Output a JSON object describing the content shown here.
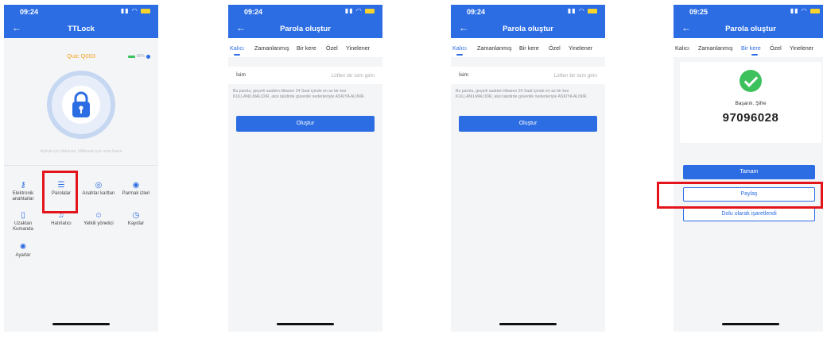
{
  "colors": {
    "primary": "#2c6de3",
    "highlight": "#e4141b",
    "success": "#3cc15c",
    "lock_name": "#f2a21d"
  },
  "screen1": {
    "time": "09:24",
    "title": "TTLock",
    "lock_name": "Quic Q003",
    "battery": "80%",
    "hint": "Açmak için dokunun, kilitlemek için uzun basın",
    "menu": [
      {
        "label": "Elektronik anahtarlar",
        "icon": "key-icon"
      },
      {
        "label": "Parolalar",
        "icon": "password-list-icon"
      },
      {
        "label": "Anahtar kartları",
        "icon": "card-icon"
      },
      {
        "label": "Parmak izleri",
        "icon": "fingerprint-icon"
      },
      {
        "label": "Uzaktan Kumanda",
        "icon": "remote-icon"
      },
      {
        "label": "Hatırlatıcı",
        "icon": "bell-icon"
      },
      {
        "label": "Yetkili yönetici",
        "icon": "admin-icon"
      },
      {
        "label": "Kayıtlar",
        "icon": "history-icon"
      },
      {
        "label": "Ayarlar",
        "icon": "settings-icon"
      }
    ]
  },
  "screen2": {
    "time": "09:24",
    "title": "Parola oluştur",
    "tabs": [
      "Kalıcı",
      "Zamanlanmış",
      "Bir kere",
      "Özel",
      "Yinelener"
    ],
    "active_tab": 0,
    "name_label": "İsim",
    "name_placeholder": "Lütfen bir isim girin",
    "note": "Bu parola, geçerli saatten itibaren 24 Saat içinde en az bir kez KULLANILMALIDIR, aksi takdirde güvenlik nedenleriyle ASKIYA ALINIR.",
    "button": "Oluştur"
  },
  "screen3": {
    "time": "09:24",
    "title": "Parola oluştur",
    "tabs": [
      "Kalıcı",
      "Zamanlanmış",
      "Bir kere",
      "Özel",
      "Yinelener"
    ],
    "active_tab": 0,
    "name_label": "İsim",
    "name_placeholder": "Lütfen bir isim girin",
    "note": "Bu parola, geçerli saatten itibaren 24 Saat içinde en az bir kez KULLANILMALIDIR, aksi takdirde güvenlik nedenleriyle ASKIYA ALINIR.",
    "button": "Oluştur"
  },
  "screen4": {
    "time": "09:25",
    "title": "Parola oluştur",
    "tabs": [
      "Kalıcı",
      "Zamanlanmış",
      "Bir kere",
      "Özel",
      "Yinelener"
    ],
    "active_tab": 2,
    "success_label": "Başarılı. Şifre",
    "code": "97096028",
    "buttons": {
      "ok": "Tamam",
      "share": "Paylaş",
      "mark_full": "Dolu olarak işaretlendi"
    }
  }
}
